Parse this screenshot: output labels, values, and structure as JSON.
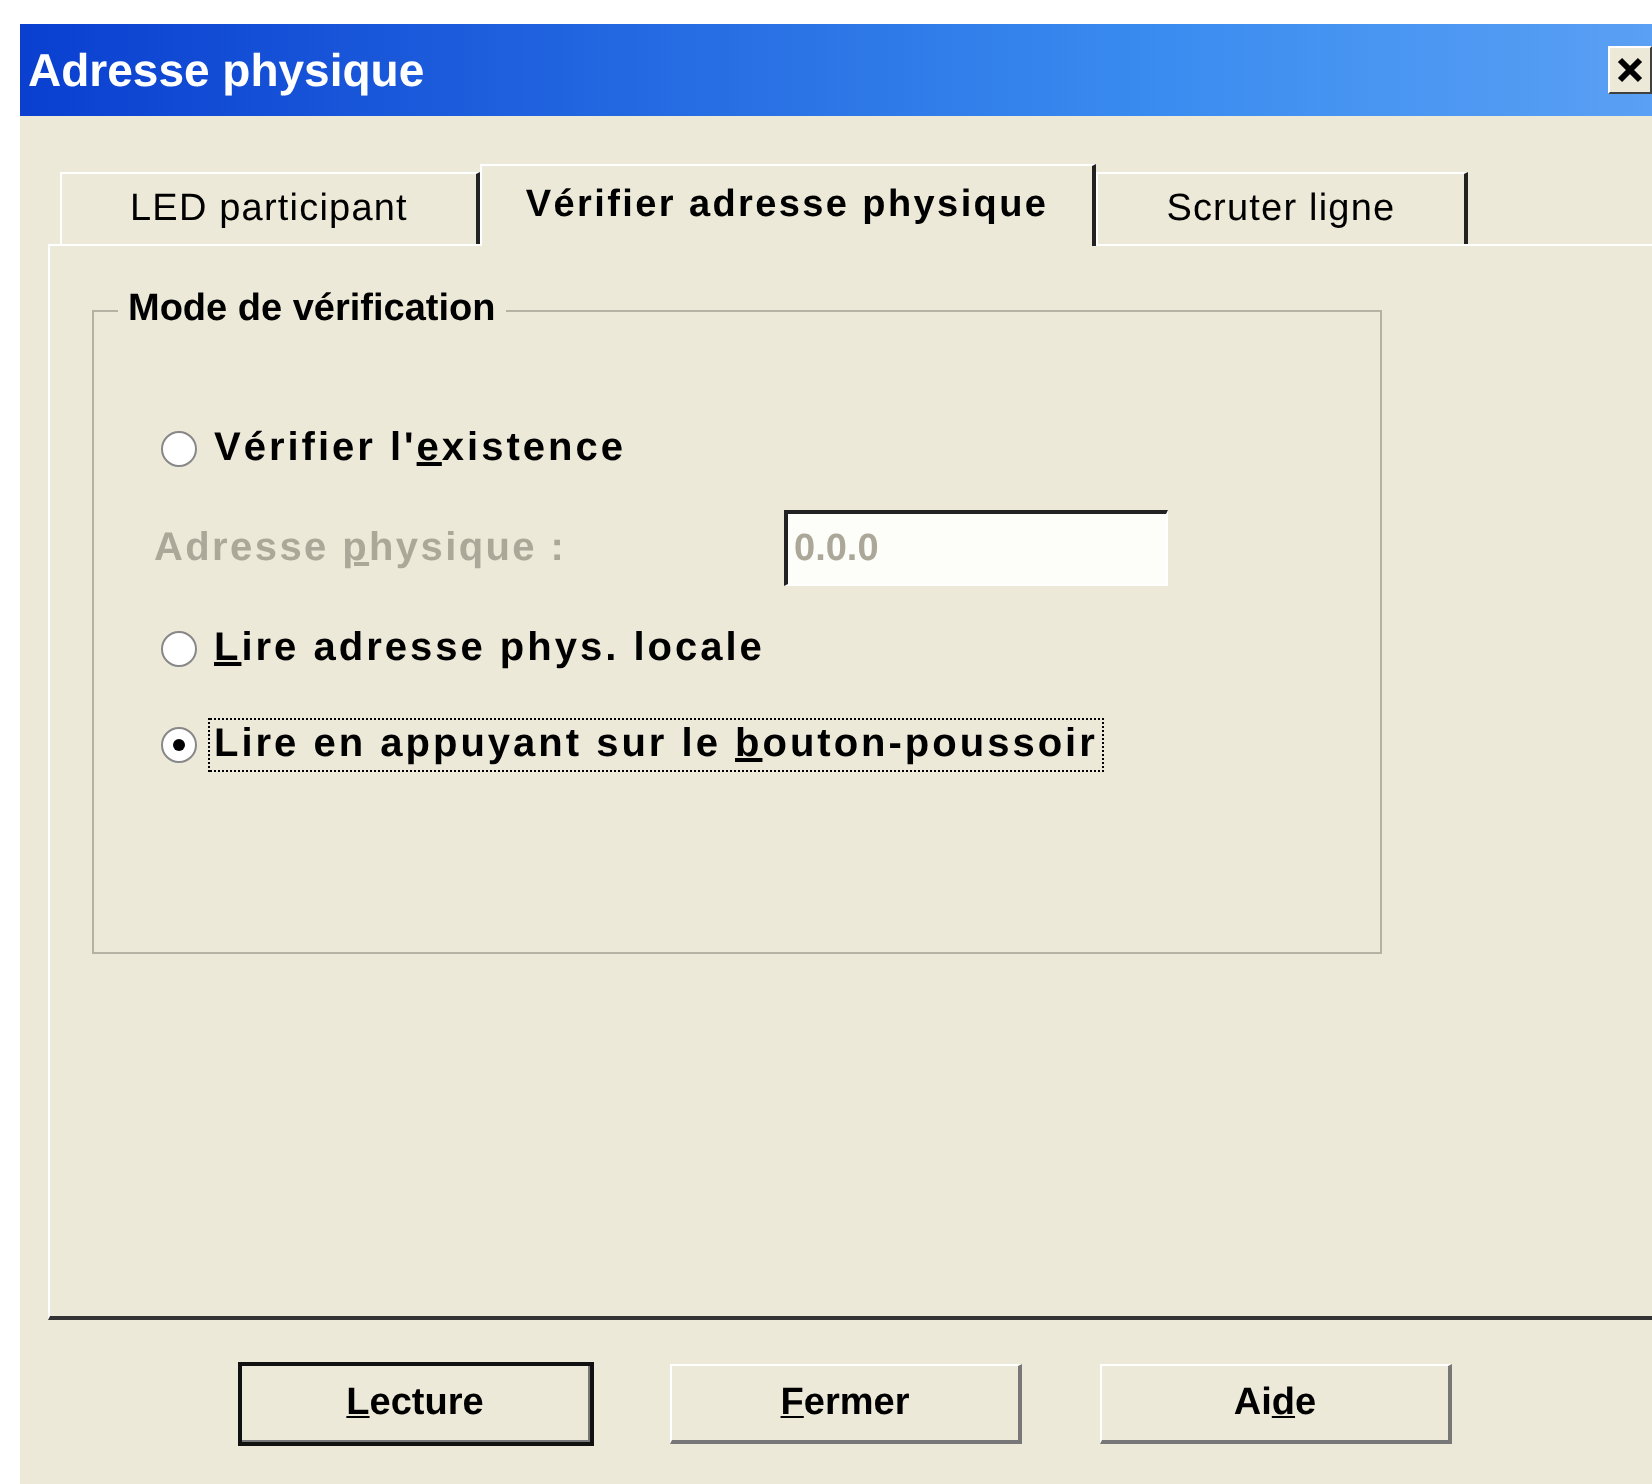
{
  "window": {
    "title": "Adresse physique"
  },
  "tabs": [
    {
      "label": "LED participant",
      "selected": false
    },
    {
      "label": "Vérifier adresse physique",
      "selected": true
    },
    {
      "label": "Scruter ligne",
      "selected": false
    }
  ],
  "group": {
    "title": "Mode de vérification",
    "rows": [
      {
        "kind": "radio",
        "selected": false,
        "focused": false,
        "segments": [
          {
            "text": "Vérifier l'",
            "underline": false
          },
          {
            "text": "e",
            "underline": true
          },
          {
            "text": "xistence",
            "underline": false
          }
        ]
      },
      {
        "kind": "field",
        "disabled": true,
        "value": "0.0.0",
        "segments": [
          {
            "text": "Adresse ",
            "underline": false
          },
          {
            "text": "p",
            "underline": true
          },
          {
            "text": "hysique :",
            "underline": false
          }
        ]
      },
      {
        "kind": "radio",
        "selected": false,
        "focused": false,
        "segments": [
          {
            "text": "L",
            "underline": true
          },
          {
            "text": "ire adresse phys. locale",
            "underline": false
          }
        ]
      },
      {
        "kind": "radio",
        "selected": true,
        "focused": true,
        "segments": [
          {
            "text": "Lire en appuyant sur le ",
            "underline": false
          },
          {
            "text": "b",
            "underline": true
          },
          {
            "text": "outon-poussoir",
            "underline": false
          }
        ]
      }
    ]
  },
  "buttons": [
    {
      "default": true,
      "segments": [
        {
          "text": "L",
          "underline": true
        },
        {
          "text": "ecture",
          "underline": false
        }
      ]
    },
    {
      "default": false,
      "segments": [
        {
          "text": "F",
          "underline": true
        },
        {
          "text": "ermer",
          "underline": false
        }
      ]
    },
    {
      "default": false,
      "segments": [
        {
          "text": "Ai",
          "underline": false
        },
        {
          "text": "d",
          "underline": true
        },
        {
          "text": "e",
          "underline": false
        }
      ]
    }
  ]
}
